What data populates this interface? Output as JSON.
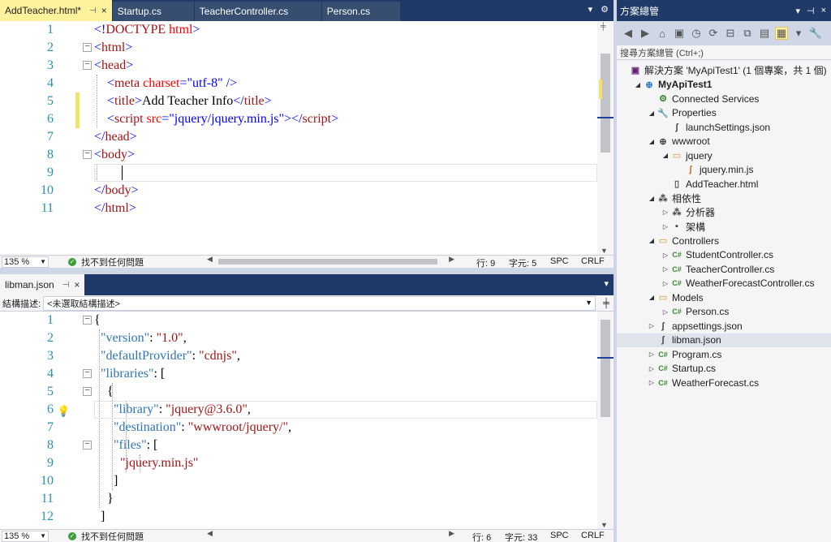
{
  "top_editor": {
    "tabs": [
      {
        "label": "AddTeacher.html*",
        "active": true
      },
      {
        "label": "Startup.cs"
      },
      {
        "label": "TeacherController.cs"
      },
      {
        "label": "Person.cs"
      }
    ],
    "tab_pin": "⊣",
    "tab_close": "×",
    "tools": [
      "▾",
      "⚙"
    ],
    "lines": [
      {
        "n": "1",
        "parts": [
          [
            "c-punct",
            "<!"
          ],
          [
            "c-tag",
            "DOCTYPE"
          ],
          [
            "c-attr",
            " html"
          ],
          [
            "c-punct",
            ">"
          ]
        ]
      },
      {
        "n": "2",
        "fold": "−",
        "parts": [
          [
            "c-punct",
            "<"
          ],
          [
            "c-tag",
            "html"
          ],
          [
            "c-punct",
            ">"
          ]
        ]
      },
      {
        "n": "3",
        "fold": "−",
        "parts": [
          [
            "c-punct",
            "<"
          ],
          [
            "c-tag",
            "head"
          ],
          [
            "c-punct",
            ">"
          ]
        ]
      },
      {
        "n": "4",
        "parts": [
          [
            "c-text",
            "    "
          ],
          [
            "c-punct",
            "<"
          ],
          [
            "c-tag",
            "meta"
          ],
          [
            "c-attr",
            " charset"
          ],
          [
            "c-punct",
            "="
          ],
          [
            "c-val",
            "\"utf-8\""
          ],
          [
            "c-punct",
            " />"
          ]
        ]
      },
      {
        "n": "5",
        "parts": [
          [
            "c-text",
            "    "
          ],
          [
            "c-punct",
            "<"
          ],
          [
            "c-tag",
            "title"
          ],
          [
            "c-punct",
            ">"
          ],
          [
            "c-text",
            "Add Teacher Info"
          ],
          [
            "c-punct",
            "</"
          ],
          [
            "c-tag",
            "title"
          ],
          [
            "c-punct",
            ">"
          ]
        ]
      },
      {
        "n": "6",
        "parts": [
          [
            "c-text",
            "    "
          ],
          [
            "c-punct",
            "<"
          ],
          [
            "c-tag",
            "script"
          ],
          [
            "c-attr",
            " src"
          ],
          [
            "c-punct",
            "="
          ],
          [
            "c-val",
            "\"jquery/jquery.min.js\""
          ],
          [
            "c-punct",
            "></"
          ],
          [
            "c-tag",
            "script"
          ],
          [
            "c-punct",
            ">"
          ]
        ]
      },
      {
        "n": "7",
        "parts": [
          [
            "c-punct",
            "</"
          ],
          [
            "c-tag",
            "head"
          ],
          [
            "c-punct",
            ">"
          ]
        ]
      },
      {
        "n": "8",
        "fold": "−",
        "parts": [
          [
            "c-punct",
            "<"
          ],
          [
            "c-tag",
            "body"
          ],
          [
            "c-punct",
            ">"
          ]
        ]
      },
      {
        "n": "9",
        "parts": []
      },
      {
        "n": "10",
        "parts": [
          [
            "c-punct",
            "</"
          ],
          [
            "c-tag",
            "body"
          ],
          [
            "c-punct",
            ">"
          ]
        ]
      },
      {
        "n": "11",
        "parts": [
          [
            "c-punct",
            "</"
          ],
          [
            "c-tag",
            "html"
          ],
          [
            "c-punct",
            ">"
          ]
        ]
      }
    ],
    "status": {
      "zoom": "135 %",
      "issues": "找不到任何問題",
      "line": "行: 9",
      "col": "字元: 5",
      "spc": "SPC",
      "crlf": "CRLF"
    }
  },
  "bottom_editor": {
    "tabs": [
      {
        "label": "libman.json",
        "active": true
      }
    ],
    "tab_pin": "⊣",
    "tab_close": "×",
    "tools": [
      "▾"
    ],
    "nav_label": "結構描述:",
    "nav_value": "<未選取結構描述>",
    "lines": [
      {
        "n": "1",
        "fold": "−",
        "parts": [
          [
            "c-blk",
            "{"
          ]
        ]
      },
      {
        "n": "2",
        "parts": [
          [
            "c-key",
            "  \"version\""
          ],
          [
            "c-blk",
            ": "
          ],
          [
            "c-str",
            "\"1.0\""
          ],
          [
            "c-blk",
            ","
          ]
        ]
      },
      {
        "n": "3",
        "parts": [
          [
            "c-key",
            "  \"defaultProvider\""
          ],
          [
            "c-blk",
            ": "
          ],
          [
            "c-str",
            "\"cdnjs\""
          ],
          [
            "c-blk",
            ","
          ]
        ]
      },
      {
        "n": "4",
        "fold": "−",
        "parts": [
          [
            "c-key",
            "  \"libraries\""
          ],
          [
            "c-blk",
            ": ["
          ]
        ]
      },
      {
        "n": "5",
        "fold": "−",
        "parts": [
          [
            "c-blk",
            "    {"
          ]
        ]
      },
      {
        "n": "6",
        "bulb": true,
        "parts": [
          [
            "c-key",
            "      \"library\""
          ],
          [
            "c-blk",
            ": "
          ],
          [
            "c-str",
            "\"jquery@3.6.0\""
          ],
          [
            "c-blk",
            ","
          ]
        ]
      },
      {
        "n": "7",
        "parts": [
          [
            "c-key",
            "      \"destination\""
          ],
          [
            "c-blk",
            ": "
          ],
          [
            "c-str",
            "\"wwwroot/jquery/\""
          ],
          [
            "c-blk",
            ","
          ]
        ]
      },
      {
        "n": "8",
        "fold": "−",
        "parts": [
          [
            "c-key",
            "      \"files\""
          ],
          [
            "c-blk",
            ": ["
          ]
        ]
      },
      {
        "n": "9",
        "parts": [
          [
            "c-str",
            "        \"jquery.min.js\""
          ]
        ]
      },
      {
        "n": "10",
        "parts": [
          [
            "c-blk",
            "      ]"
          ]
        ]
      },
      {
        "n": "11",
        "parts": [
          [
            "c-blk",
            "    }"
          ]
        ]
      },
      {
        "n": "12",
        "parts": [
          [
            "c-blk",
            "  ]"
          ]
        ]
      }
    ],
    "status": {
      "zoom": "135 %",
      "issues": "找不到任何問題",
      "line": "行: 6",
      "col": "字元: 33",
      "spc": "SPC",
      "crlf": "CRLF"
    }
  },
  "solution_explorer": {
    "title": "方案總管",
    "title_tools": [
      "▾",
      "⊣",
      "×"
    ],
    "toolbar_icons": [
      "back-icon",
      "forward-icon",
      "home-icon",
      "vs-icon",
      "pending-changes-icon",
      "sync-icon",
      "collapse-icon",
      "copy-icon",
      "properties-icon",
      "show-all-icon",
      "dropdown-icon",
      "wrench-icon"
    ],
    "toolbar_glyphs": [
      "◀",
      "▶",
      "⌂",
      "▣",
      "◷",
      "⟳",
      "⊟",
      "⧉",
      "▤",
      "▦",
      "▾",
      "🔧"
    ],
    "search_placeholder": "搜尋方案總管 (Ctrl+;)",
    "nodes": [
      {
        "label": "解決方案 'MyApiTest1' (1 個專案，共 1 個)",
        "indent": 0,
        "exp": "",
        "icon": "sol",
        "glyph": "▣",
        "iname": "solution-icon"
      },
      {
        "label": "MyApiTest1",
        "indent": 1,
        "exp": "◢",
        "icon": "proj",
        "glyph": "⊕",
        "iname": "project-icon",
        "bold": true
      },
      {
        "label": "Connected Services",
        "indent": 2,
        "exp": "",
        "icon": "conn",
        "glyph": "⚙",
        "iname": "connected-services-icon"
      },
      {
        "label": "Properties",
        "indent": 2,
        "exp": "◢",
        "icon": "wrench",
        "glyph": "🔧",
        "iname": "properties-icon"
      },
      {
        "label": "launchSettings.json",
        "indent": 3,
        "exp": "",
        "icon": "json",
        "glyph": "ʃ",
        "iname": "json-file-icon"
      },
      {
        "label": "wwwroot",
        "indent": 2,
        "exp": "◢",
        "icon": "globe",
        "glyph": "⊕",
        "iname": "globe-icon"
      },
      {
        "label": "jquery",
        "indent": 3,
        "exp": "◢",
        "icon": "folder",
        "glyph": "▭",
        "iname": "folder-icon"
      },
      {
        "label": "jquery.min.js",
        "indent": 4,
        "exp": "",
        "icon": "js",
        "glyph": "ʃ",
        "iname": "js-file-icon"
      },
      {
        "label": "AddTeacher.html",
        "indent": 3,
        "exp": "",
        "icon": "html",
        "glyph": "▯",
        "iname": "html-file-icon"
      },
      {
        "label": "相依性",
        "indent": 2,
        "exp": "◢",
        "icon": "dep",
        "glyph": "⁂",
        "iname": "dependencies-icon"
      },
      {
        "label": "分析器",
        "indent": 3,
        "exp": "▷",
        "icon": "dep",
        "glyph": "⁂",
        "iname": "analyzers-icon"
      },
      {
        "label": "架構",
        "indent": 3,
        "exp": "▷",
        "icon": "dep",
        "glyph": "▪",
        "iname": "frameworks-icon"
      },
      {
        "label": "Controllers",
        "indent": 2,
        "exp": "◢",
        "icon": "folder",
        "glyph": "▭",
        "iname": "folder-icon"
      },
      {
        "label": "StudentController.cs",
        "indent": 3,
        "exp": "▷",
        "icon": "cs",
        "glyph": "C#",
        "iname": "csharp-file-icon"
      },
      {
        "label": "TeacherController.cs",
        "indent": 3,
        "exp": "▷",
        "icon": "cs",
        "glyph": "C#",
        "iname": "csharp-file-icon"
      },
      {
        "label": "WeatherForecastController.cs",
        "indent": 3,
        "exp": "▷",
        "icon": "cs",
        "glyph": "C#",
        "iname": "csharp-file-icon"
      },
      {
        "label": "Models",
        "indent": 2,
        "exp": "◢",
        "icon": "folder",
        "glyph": "▭",
        "iname": "folder-icon"
      },
      {
        "label": "Person.cs",
        "indent": 3,
        "exp": "▷",
        "icon": "cs",
        "glyph": "C#",
        "iname": "csharp-file-icon"
      },
      {
        "label": "appsettings.json",
        "indent": 2,
        "exp": "▷",
        "icon": "json",
        "glyph": "ʃ",
        "iname": "json-file-icon"
      },
      {
        "label": "libman.json",
        "indent": 2,
        "exp": "",
        "icon": "json",
        "glyph": "ʃ",
        "iname": "json-file-icon",
        "selected": true
      },
      {
        "label": "Program.cs",
        "indent": 2,
        "exp": "▷",
        "icon": "cs",
        "glyph": "C#",
        "iname": "csharp-file-icon"
      },
      {
        "label": "Startup.cs",
        "indent": 2,
        "exp": "▷",
        "icon": "cs",
        "glyph": "C#",
        "iname": "csharp-file-icon"
      },
      {
        "label": "WeatherForecast.cs",
        "indent": 2,
        "exp": "▷",
        "icon": "cs",
        "glyph": "C#",
        "iname": "csharp-file-icon"
      }
    ]
  },
  "colors": {
    "chrome": "#1f3a68",
    "active_tab": "#fff29d",
    "change_bar": "#efe36a",
    "selected_node": "#dfe3ec"
  }
}
